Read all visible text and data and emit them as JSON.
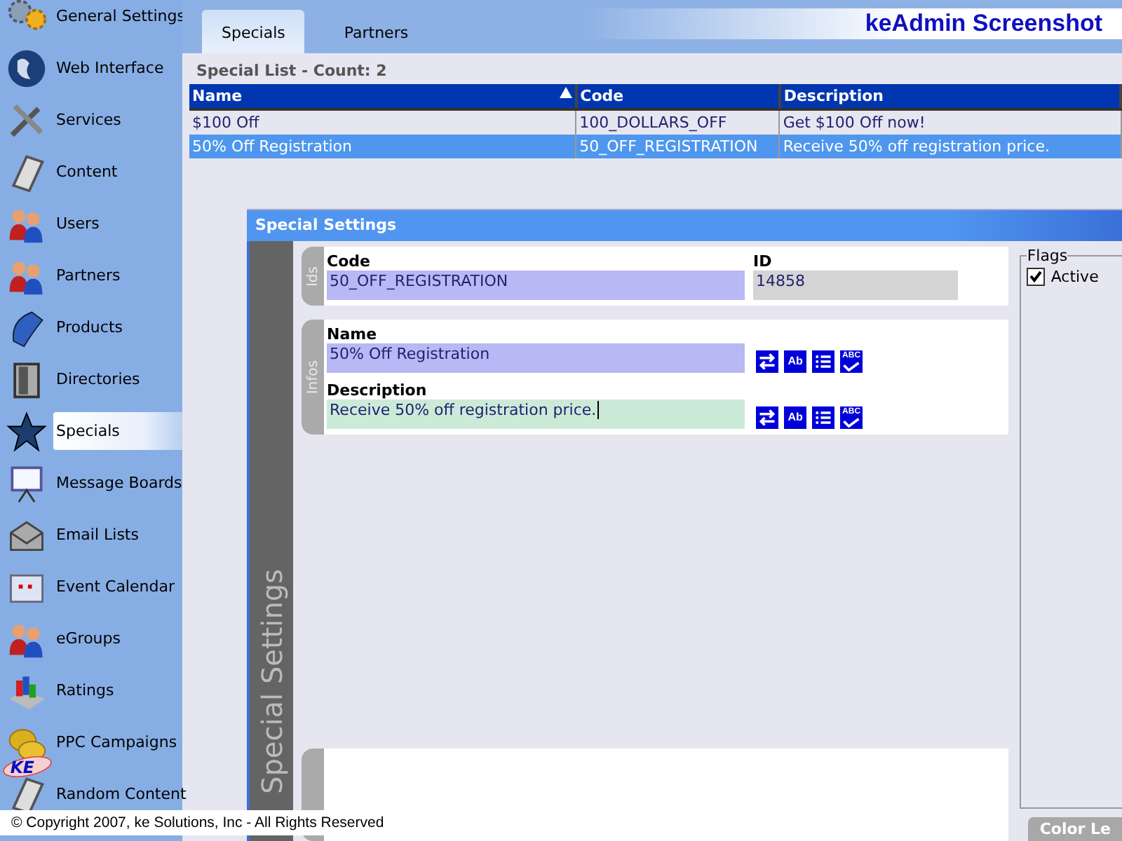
{
  "sidebar": {
    "items": [
      {
        "label": "General Settings",
        "selected": false
      },
      {
        "label": "Web Interface",
        "selected": false
      },
      {
        "label": "Services",
        "selected": false
      },
      {
        "label": "Content",
        "selected": false
      },
      {
        "label": "Users",
        "selected": false
      },
      {
        "label": "Partners",
        "selected": false
      },
      {
        "label": "Products",
        "selected": false
      },
      {
        "label": "Directories",
        "selected": false
      },
      {
        "label": "Specials",
        "selected": true
      },
      {
        "label": "Message Boards",
        "selected": false
      },
      {
        "label": "Email Lists",
        "selected": false
      },
      {
        "label": "Event Calendar",
        "selected": false
      },
      {
        "label": "eGroups",
        "selected": false
      },
      {
        "label": "Ratings",
        "selected": false
      },
      {
        "label": "PPC Campaigns",
        "selected": false
      },
      {
        "label": "Random Content",
        "selected": false
      }
    ]
  },
  "logo": {
    "text": "KE"
  },
  "tabs": [
    {
      "label": "Specials",
      "selected": true
    },
    {
      "label": "Partners",
      "selected": false
    }
  ],
  "app_title": "keAdmin Screenshot",
  "list_title": "Special List - Count: 2",
  "table": {
    "columns": [
      {
        "label": "Name",
        "sorted": true
      },
      {
        "label": "Code",
        "sorted": false
      },
      {
        "label": "Description",
        "sorted": false
      }
    ],
    "rows": [
      {
        "cells": [
          "$100 Off",
          "100_DOLLARS_OFF",
          "Get $100 Off now!"
        ],
        "selected": false
      },
      {
        "cells": [
          "50% Off Registration",
          "50_OFF_REGISTRATION",
          "Receive 50% off registration price."
        ],
        "selected": true
      }
    ]
  },
  "settings": {
    "title": "Special Settings",
    "side_label": "Special Settings",
    "groups": [
      {
        "label": "Ids",
        "fields": [
          {
            "label": "Code",
            "value": "50_OFF_REGISTRATION",
            "kind": "code"
          },
          {
            "label": "ID",
            "value": "14858",
            "kind": "readonly"
          }
        ]
      },
      {
        "label": "Infos",
        "fields": [
          {
            "label": "Name",
            "value": "50% Off Registration",
            "kind": "text",
            "tools": [
              {
                "kind": "swap"
              },
              {
                "kind": "format",
                "label": "Ab"
              },
              {
                "kind": "list"
              },
              {
                "kind": "spell",
                "label": "ABC"
              }
            ]
          },
          {
            "label": "Description",
            "value": "Receive 50% off registration price.",
            "kind": "focused",
            "tools": [
              {
                "kind": "swap"
              },
              {
                "kind": "format",
                "label": "Ab"
              },
              {
                "kind": "list"
              },
              {
                "kind": "spell",
                "label": "ABC"
              }
            ]
          }
        ]
      }
    ],
    "flags": {
      "legend": "Flags",
      "items": [
        {
          "label": "Active",
          "checked": true
        }
      ]
    },
    "color_legend": "Color Le"
  },
  "footer": "© Copyright 2007, ke Solutions, Inc - All Rights Reserved"
}
